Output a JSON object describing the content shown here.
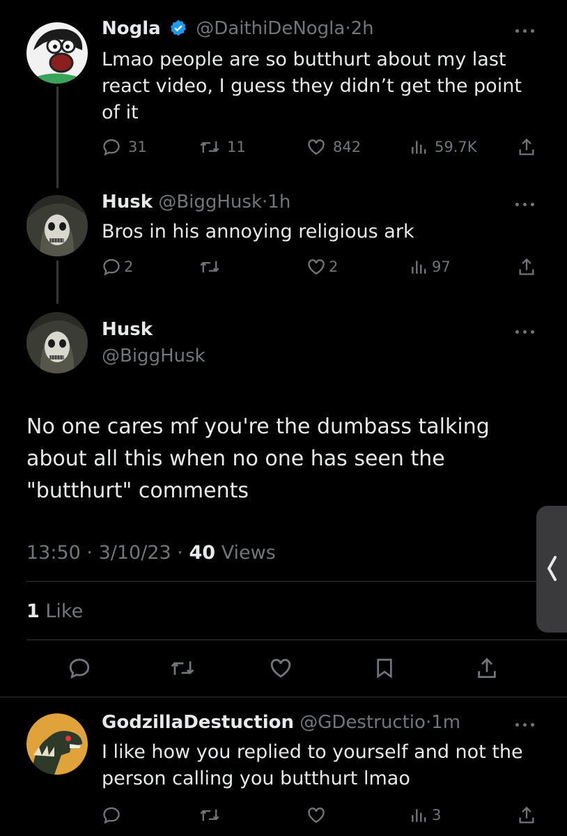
{
  "tweet1": {
    "name": "Nogla",
    "handle": "@DaithiDeNogla",
    "time": "2h",
    "text": "Lmao people are so butthurt about my last react video, I guess they didn’t get the point of it",
    "replies": "31",
    "retweets": "11",
    "likes": "842",
    "views": "59.7K"
  },
  "tweet2": {
    "name": "Husk",
    "handle": "@BiggHusk",
    "time": "1h",
    "text": "Bros in his annoying religious ark",
    "replies": "2",
    "retweets": "",
    "likes": "2",
    "views": "97"
  },
  "main": {
    "name": "Husk",
    "handle": "@BiggHusk",
    "text": "No one cares mf you're the dumbass talking about all this when no one has seen the \"butthurt\" comments",
    "time": "13:50",
    "date": "3/10/23",
    "views_count": "40",
    "views_label": "Views",
    "likes_count": "1",
    "likes_label": "Like"
  },
  "reply": {
    "name": "GodzillaDestuction",
    "handle": "@GDestructio",
    "time": "1m",
    "text": "I like how you replied to yourself and not the person calling you butthurt lmao",
    "replies": "",
    "retweets": "",
    "likes": "",
    "views": "3"
  },
  "separator": "·",
  "colors": {
    "background": "#000000",
    "text": "#e7e9ea",
    "muted": "#71767b",
    "verified": "#1d9bf0",
    "divider": "#2f3336"
  },
  "icons": [
    "reply-icon",
    "retweet-icon",
    "like-icon",
    "views-icon",
    "share-icon",
    "bookmark-icon",
    "verified-badge-icon",
    "more-icon",
    "chevron-left-icon"
  ]
}
